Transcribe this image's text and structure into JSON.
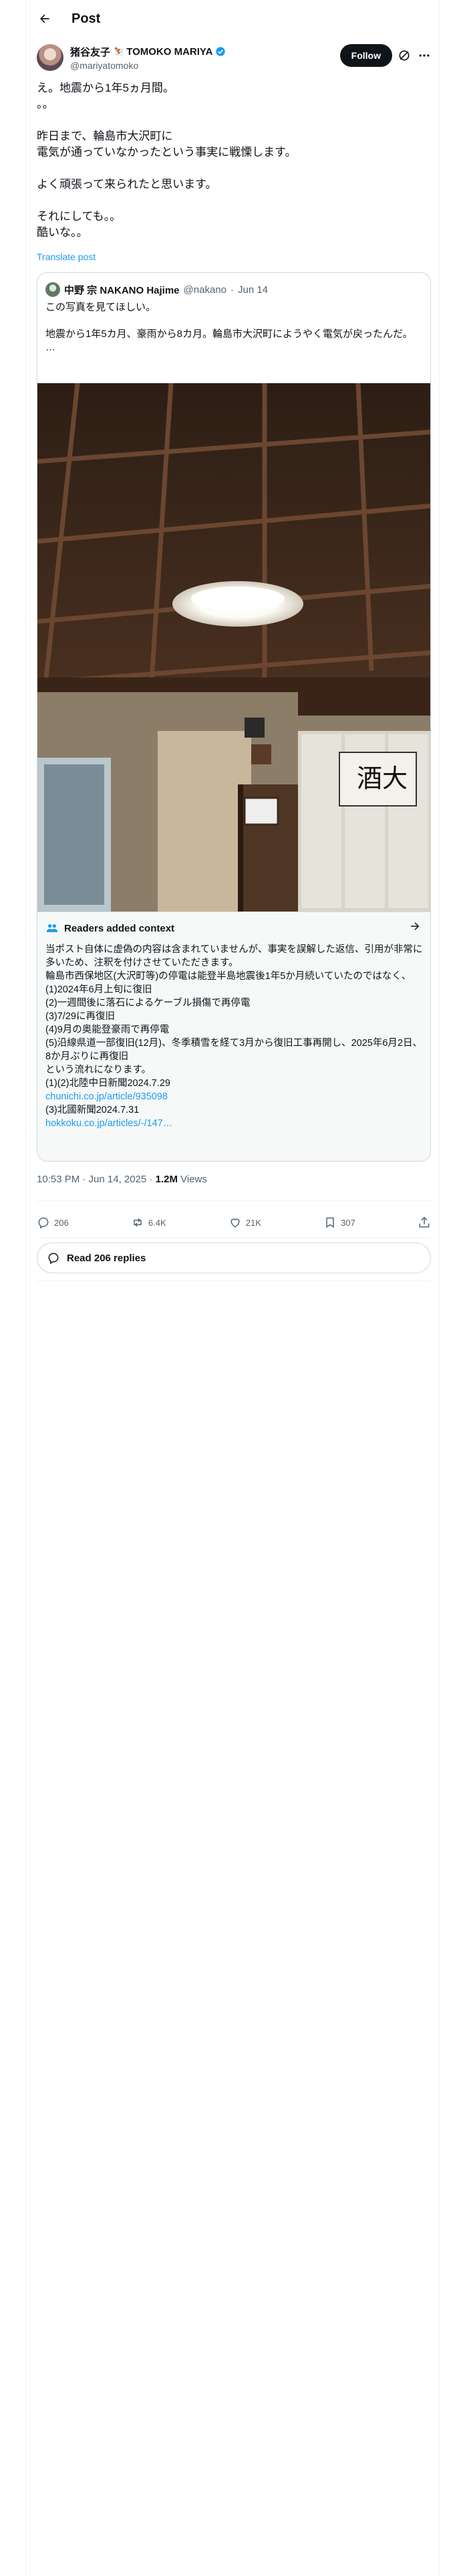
{
  "header": {
    "title": "Post"
  },
  "author": {
    "name": "猪谷友子",
    "name_emoji": "⛷️",
    "name_latin": "TOMOKO MARIYA",
    "handle": "@mariyatomoko",
    "follow_label": "Follow"
  },
  "post": {
    "text": "え。地震から1年5ヵ月間。\n。。\n\n昨日まで、輪島市大沢町に\n電気が通っていなかったという事実に戦慄します。\n\nよく頑張って来られたと思います。\n\nそれにしても。。\n酷いな。。",
    "translate_label": "Translate post"
  },
  "quote": {
    "name": "中野 宗 NAKANO Hajime",
    "handle": "@nakano",
    "date": "Jun 14",
    "text": "この写真を見てほしい。\n\n地震から1年5カ月、豪雨から8カ月。輪島市大沢町にようやく電気が戻ったんだ。\n…"
  },
  "context": {
    "title": "Readers added context",
    "lines": [
      "当ポスト自体に虚偽の内容は含まれていませんが、事実を誤解した返信、引用が非常に多いため、注釈を付けさせていただきます。",
      "輪島市西保地区(大沢町等)の停電は能登半島地震後1年5か月続いていたのではなく、",
      "(1)2024年6月上旬に復旧",
      "(2)一週間後に落石によるケーブル損傷で再停電",
      "(3)7/29に再復旧",
      "(4)9月の奥能登豪雨で再停電",
      "(5)沿線県道一部復旧(12月)、冬季積雪を経て3月から復旧工事再開し、2025年6月2日、8か月ぶりに再復旧",
      "という流れになります。",
      "(1)(2)北陸中日新聞2024.7.29"
    ],
    "link1": "chunichi.co.jp/article/935098",
    "line_after_link1": "(3)北國新聞2024.7.31",
    "link2": "hokkoku.co.jp/articles/-/147…"
  },
  "meta": {
    "time": "10:53 PM · Jun 14, 2025 · ",
    "views_count": "1.2M",
    "views_label": " Views"
  },
  "actions": {
    "replies": "206",
    "reposts": "6.4K",
    "likes": "21K",
    "bookmarks": "307"
  },
  "read_replies_label": "Read 206 replies",
  "icons": [
    "back-arrow-icon",
    "verified-badge-icon",
    "grok-icon",
    "more-icon",
    "readers-icon",
    "arrow-right-icon",
    "reply-icon",
    "repost-icon",
    "like-icon",
    "bookmark-icon",
    "share-icon",
    "speech-bubble-icon"
  ],
  "colors": {
    "link": "#1d9bf0",
    "text": "#0f1419",
    "muted": "#536471",
    "border": "#cfd9de",
    "context_bg": "#f7f9f9"
  }
}
